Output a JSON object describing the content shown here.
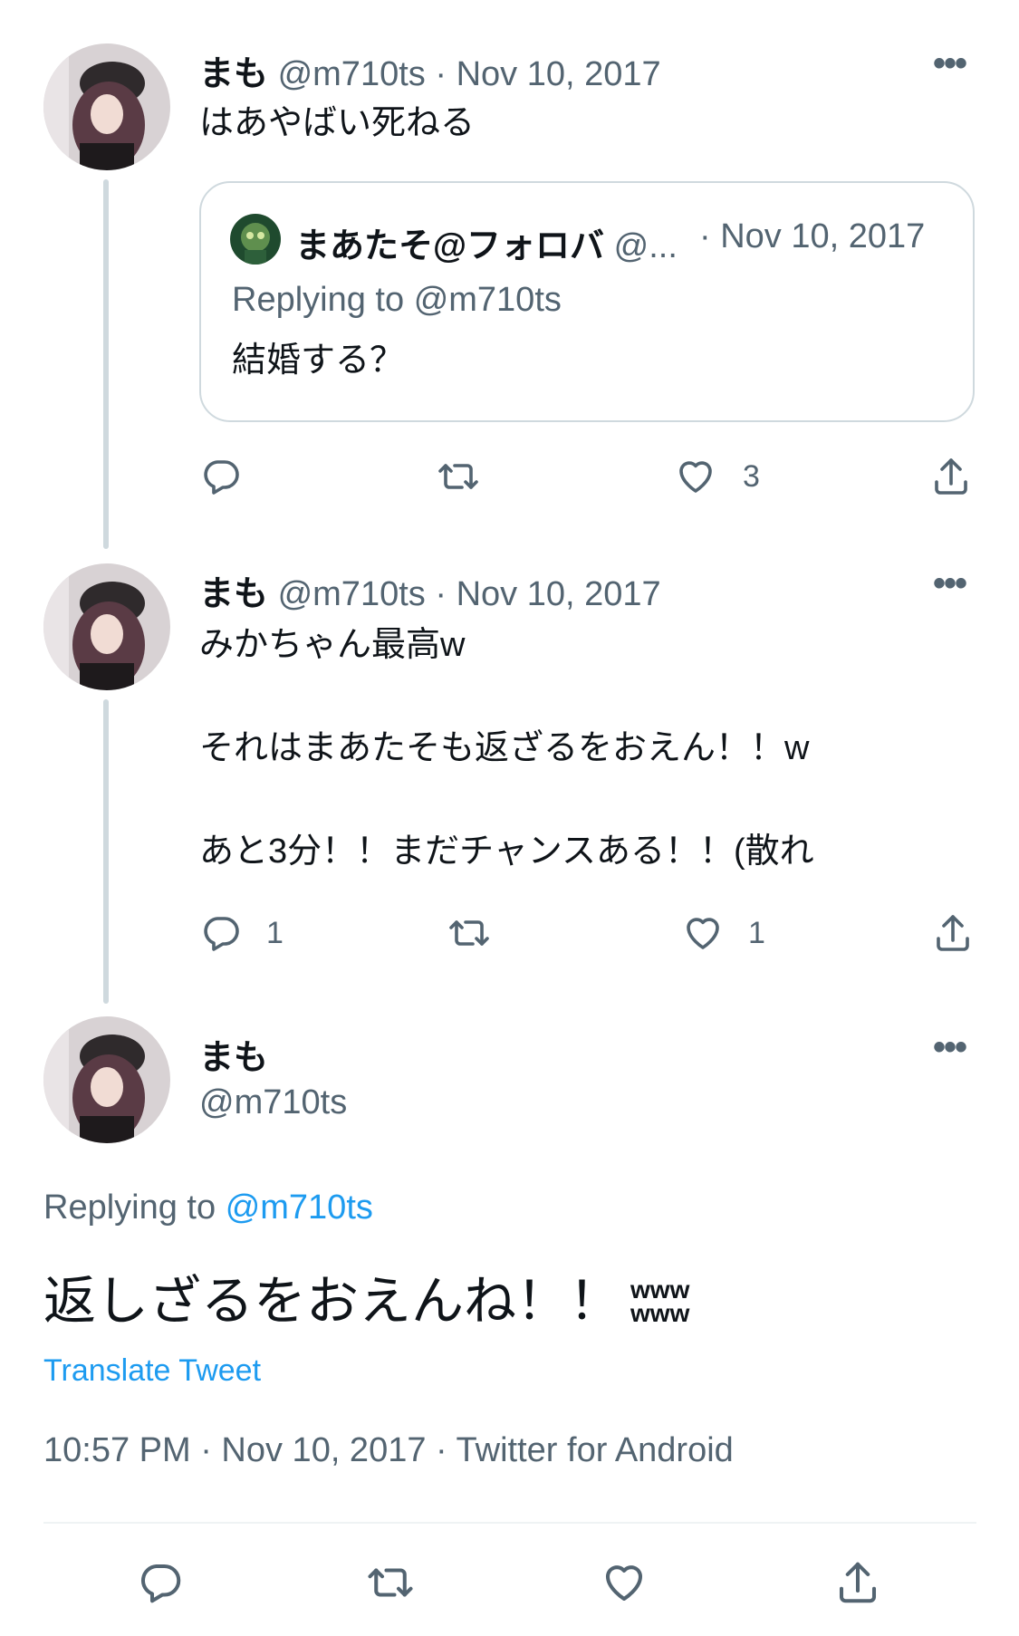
{
  "tweets": [
    {
      "name": "まも",
      "handle": "@m710ts",
      "sep": "·",
      "date": "Nov 10, 2017",
      "text": "はあやばい死ねる",
      "quote": {
        "name": "まあたそ@フォロバ",
        "handle": "@...",
        "date": "· Nov 10, 2017",
        "replying_prefix": "Replying to",
        "replying_handle": "@m710ts",
        "text": "結婚する？"
      },
      "actions": {
        "reply": "",
        "retweet": "",
        "like": "3"
      }
    },
    {
      "name": "まも",
      "handle": "@m710ts",
      "sep": "·",
      "date": "Nov 10, 2017",
      "lines": [
        "みかちゃん最高w",
        "それはまあたそも返ざるをおえん！！w",
        "あと3分！！まだチャンスある！！(散れ"
      ],
      "actions": {
        "reply": "1",
        "retweet": "",
        "like": "1"
      }
    }
  ],
  "main": {
    "name": "まも",
    "handle": "@m710ts",
    "replying_prefix": "Replying to",
    "replying_handle": "@m710ts",
    "text": "返しざるをおえんね！！",
    "text_suffix_top": "www",
    "text_suffix_bottom": "www",
    "translate": "Translate Tweet",
    "meta": "10:57 PM · Nov 10, 2017 · Twitter for Android"
  },
  "icons": [
    "reply-icon",
    "retweet-icon",
    "like-icon",
    "share-icon",
    "more-icon"
  ],
  "colors": {
    "link": "#1d9bf0",
    "muted": "#536471",
    "line": "#cfd9de"
  }
}
